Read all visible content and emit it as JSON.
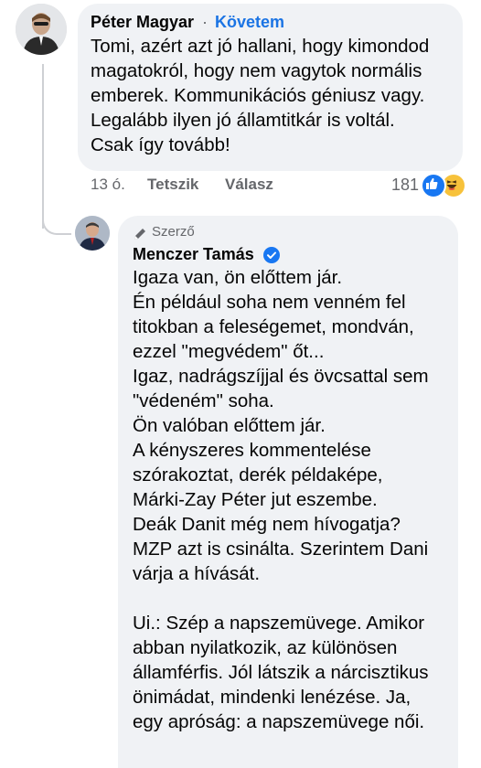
{
  "comment": {
    "author": "Péter Magyar",
    "separator": "·",
    "follow_label": "Követem",
    "text": "Tomi, azért azt jó hallani, hogy kimondod\nmagatokról, hogy nem vagytok normális\nemberek. Kommunikációs géniusz vagy.\nLegalább ilyen jó államtitkár is voltál.\nCsak így tovább!",
    "time": "13 ó.",
    "like_label": "Tetszik",
    "reply_label": "Válasz",
    "reaction_count": "181",
    "reactions": [
      "like-icon",
      "haha-icon"
    ]
  },
  "reply": {
    "badge_label": "Szerző",
    "author": "Menczer Tamás",
    "text": "Igaza van, ön előttem jár.\nÉn például soha nem venném fel\ntitokban a feleségemet, mondván,\nezzel \"megvédem\" őt...\nIgaz, nadrágszíjjal és övcsattal sem\n\"védeném\" soha.\nÖn valóban előttem jár.\nA kényszeres kommentelése\nszórakoztat, derék példaképe,\nMárki-Zay Péter jut eszembe.\nDeák Danit még nem hívogatja?\nMZP azt is csinálta. Szerintem Dani\nvárja a hívását.\n\nUi.: Szép a napszemüvege. Amikor\nabban nyilatkozik, az különösen\nállamférfis. Jól látszik a nárcisztikus\nönimádat, mindenki lenézése. Ja,\negy apróság: a napszemüvege női."
  },
  "colors": {
    "bubble": "#f0f2f5",
    "link_blue": "#1b74e4",
    "meta_gray": "#65676b",
    "like_blue": "#1877f2",
    "haha_yellow": "#f7c23b"
  }
}
